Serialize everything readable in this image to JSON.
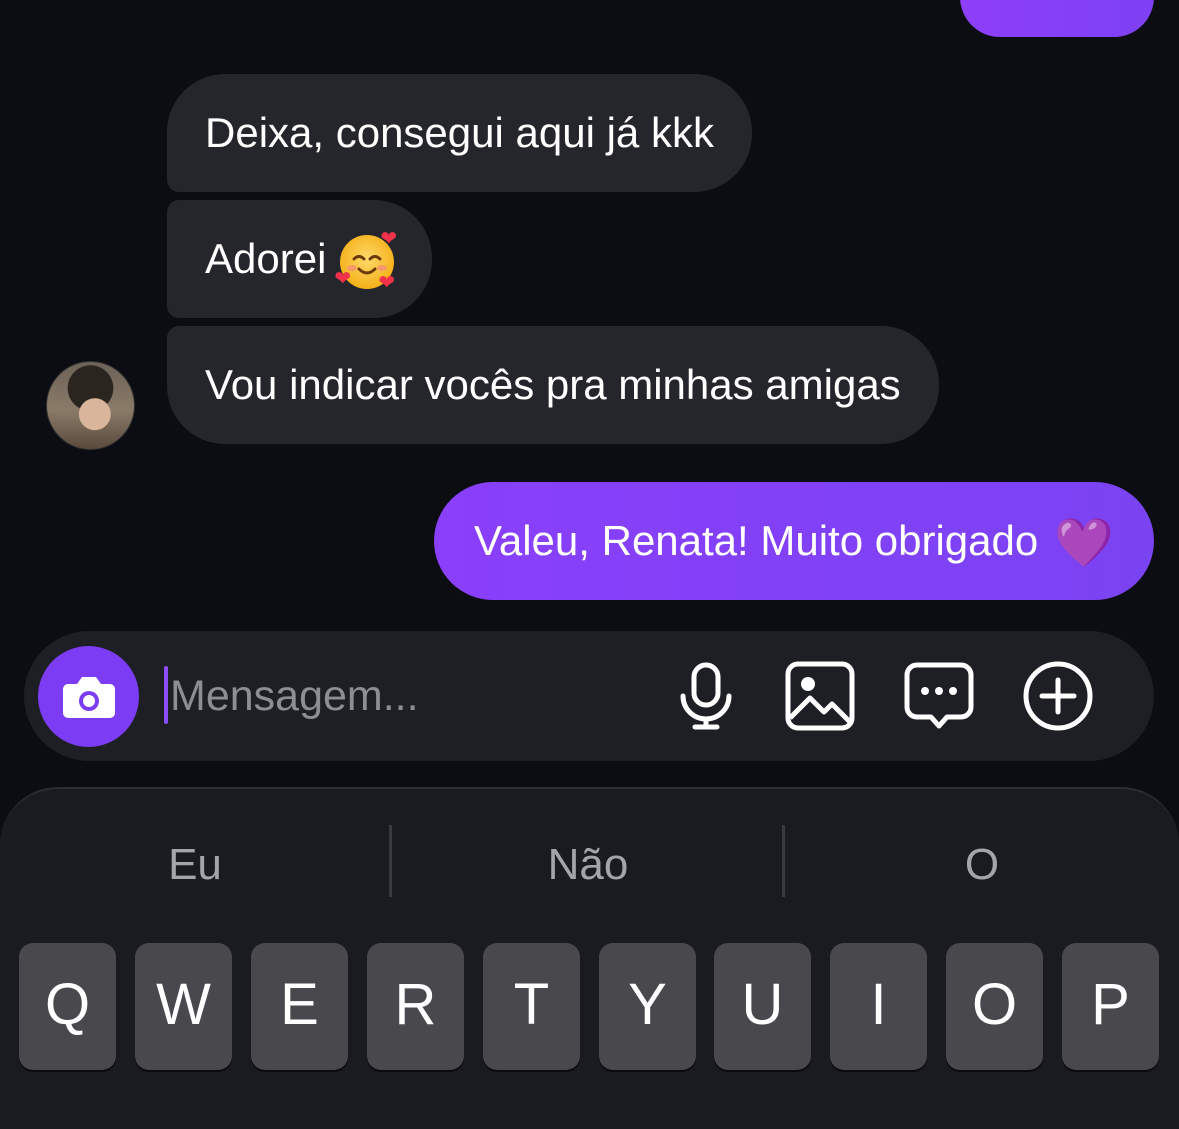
{
  "chat": {
    "incoming": [
      {
        "text": "Deixa, consegui aqui já kkk"
      },
      {
        "text": "Adorei"
      },
      {
        "text": "Vou indicar vocês pra minhas amigas"
      }
    ],
    "outgoing": {
      "text": "Valeu, Renata! Muito obrigado"
    },
    "emoji_smiling_hearts": "smiling-face-with-hearts",
    "emoji_purple_heart": "💜"
  },
  "composer": {
    "placeholder": "Mensagem...",
    "icons": [
      "camera-icon",
      "microphone-icon",
      "image-icon",
      "message-dots-icon",
      "plus-circle-icon"
    ]
  },
  "keyboard": {
    "suggestions": [
      "Eu",
      "Não",
      "O"
    ],
    "row1": [
      "Q",
      "W",
      "E",
      "R",
      "T",
      "Y",
      "U",
      "I",
      "O",
      "P"
    ]
  },
  "colors": {
    "background": "#0c0d12",
    "incoming_bubble": "#25262c",
    "outgoing_bubble": "#8a3ffb",
    "accent": "#7c3cf4",
    "key": "#48484d"
  }
}
